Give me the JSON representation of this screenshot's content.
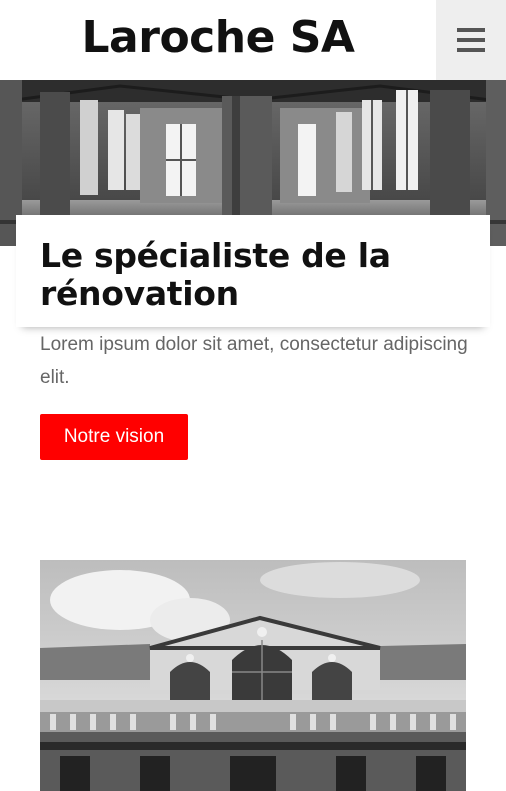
{
  "header": {
    "brand": "Laroche SA",
    "menu_icon": "hamburger-menu-icon"
  },
  "hero": {
    "image_alt": "",
    "icon": "photo"
  },
  "card": {
    "title": "Le spécialiste de la rénovation"
  },
  "intro": {
    "text": "Lorem ipsum dolor sit amet, consectetur adipiscing elit."
  },
  "cta": {
    "label": "Notre vision",
    "color": "#ff0000"
  },
  "colors": {
    "accent": "#ff0000",
    "text": "#111111",
    "muted": "#666666",
    "menu_bg": "#eeeeee"
  }
}
